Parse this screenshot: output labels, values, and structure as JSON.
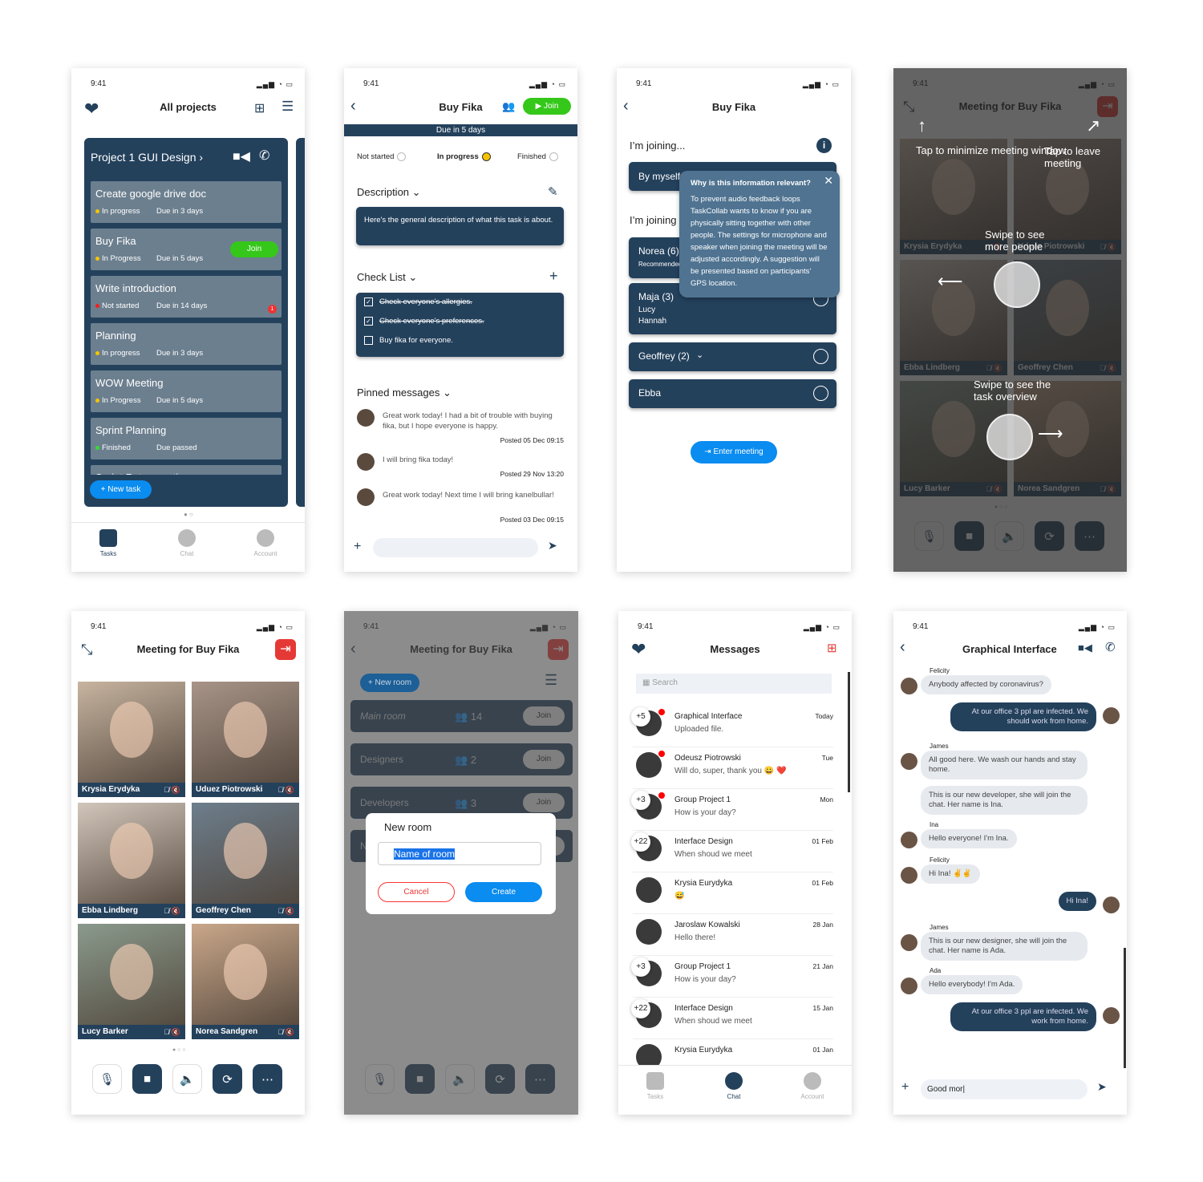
{
  "status_time": "9:41",
  "colors": {
    "navy": "#24415c",
    "accent_blue": "#0a8cf0",
    "join_green": "#35c81a",
    "danger_red": "#e53935",
    "in_progress": "#f5c400",
    "not_started": "#f02020",
    "finished": "#33dd33"
  },
  "screen1": {
    "title": "All projects",
    "project_title": "Project 1 GUI Design",
    "new_task": "New task",
    "tasks": [
      {
        "title": "Create google drive doc",
        "status": "In progress",
        "status_color": "#f5c400",
        "due": "Due in 3 days"
      },
      {
        "title": "Buy Fika",
        "status": "In Progress",
        "status_color": "#f5c400",
        "due": "Due in 5 days",
        "join": "Join"
      },
      {
        "title": "Write introduction",
        "status": "Not started",
        "status_color": "#f02020",
        "due": "Due in 14 days",
        "badge": "1"
      },
      {
        "title": "Planning",
        "status": "In progress",
        "status_color": "#f5c400",
        "due": "Due in 3 days"
      },
      {
        "title": "WOW Meeting",
        "status": "In Progress",
        "status_color": "#f5c400",
        "due": "Due in 5 days"
      },
      {
        "title": "Sprint Planning",
        "status": "Finished",
        "status_color": "#33dd33",
        "due": "Due passed"
      },
      {
        "title": "Sprint Retrospective",
        "status": "",
        "due": ""
      }
    ],
    "tabs": [
      "Tasks",
      "Chat",
      "Account"
    ],
    "active_tab": "Tasks"
  },
  "screen2": {
    "title": "Buy Fika",
    "join": "Join",
    "due_bar": "Due in 5 days",
    "statuses": [
      "Not started",
      "In progress",
      "Finished"
    ],
    "selected_status": "In progress",
    "description_label": "Description",
    "description": "Here's the general description of what this task is about.",
    "checklist_label": "Check List",
    "checklist": [
      {
        "text": "Check everyone's allergies.",
        "checked": true
      },
      {
        "text": "Check everyone's preferences.",
        "checked": true
      },
      {
        "text": "Buy fika for everyone.",
        "checked": false
      }
    ],
    "pinned_label": "Pinned messages",
    "pinned": [
      {
        "text": "Great work today! I had a bit of trouble with buying fika, but I hope everyone is happy.",
        "posted": "Posted 05 Dec 09:15"
      },
      {
        "text": "I will bring fika today!",
        "posted": "Posted 29 Nov 13:20"
      },
      {
        "text": "Great work today! Next time I will bring kanelbullar!",
        "posted": "Posted 03 Dec 09:15"
      }
    ]
  },
  "screen3": {
    "title": "Buy Fika",
    "joining_label": "I’m joining...",
    "by_myself": "By myself",
    "joining_with": "I’m joining",
    "groups": [
      {
        "name": "Norea (6)",
        "sub": "Recommended"
      },
      {
        "name": "Maja (3)",
        "members": [
          "Lucy",
          "Hannah"
        ]
      },
      {
        "name": "Geoffrey (2)"
      },
      {
        "name": "Ebba"
      }
    ],
    "tooltip_title": "Why is this information relevant?",
    "tooltip_body": "To prevent audio feedback loops TaskCollab wants to know if you are physically sitting together with other people. The settings for microphone and speaker when joining the meeting will be adjusted accordingly. A suggestion will be presented based on  participants’ GPS location.",
    "enter_meeting": "Enter meeting"
  },
  "meeting": {
    "title": "Meeting for Buy Fika",
    "participants": [
      "Krysia  Erydyka",
      "Uduez Piotrowski",
      "Ebba Lindberg",
      "Geoffrey Chen",
      "Lucy Barker",
      "Norea Sandgren"
    ]
  },
  "screen4": {
    "hint_minimize": "Tap to minimize meeting window",
    "hint_leave": "Tap to leave meeting",
    "hint_more": "Swipe to see more people",
    "hint_task": "Swipe to see the task overview"
  },
  "screen6": {
    "new_room_button": "+ New room",
    "rooms": [
      {
        "name": "Main room",
        "count": "14"
      },
      {
        "name": "Designers",
        "count": "2"
      },
      {
        "name": "Developers",
        "count": "3"
      },
      {
        "name": "N",
        "count": ""
      }
    ],
    "join": "Join",
    "dialog_title": "New room",
    "dialog_value": "Name of room",
    "cancel": "Cancel",
    "create": "Create"
  },
  "screen7": {
    "title": "Messages",
    "search_placeholder": "Search",
    "chats": [
      {
        "count": "+5",
        "name": "Graphical Interface",
        "text": "Uploaded file.",
        "date": "Today",
        "unread": true
      },
      {
        "name": "Odeusz Piotrowski",
        "text": "Will do, super, thank you  😀 ❤️",
        "date": "Tue",
        "unread": true
      },
      {
        "count": "+3",
        "name": "Group Project 1",
        "text": "How is your day?",
        "date": "Mon",
        "unread": true
      },
      {
        "count": "+22",
        "name": "Interface Design",
        "text": "When shoud we meet",
        "date": "01 Feb"
      },
      {
        "name": "Krysia Eurydyka",
        "text": "😅",
        "date": "01 Feb"
      },
      {
        "name": "Jaroslaw Kowalski",
        "text": "Hello there!",
        "date": "28 Jan"
      },
      {
        "count": "+3",
        "name": "Group Project 1",
        "text": "How is your day?",
        "date": "21 Jan"
      },
      {
        "count": "+22",
        "name": "Interface Design",
        "text": "When shoud we meet",
        "date": "15 Jan"
      },
      {
        "name": "Krysia Eurydyka",
        "text": "",
        "date": "01 Jan"
      }
    ],
    "tabs": [
      "Tasks",
      "Chat",
      "Account"
    ],
    "active_tab": "Chat"
  },
  "screen8": {
    "title": "Graphical Interface",
    "input_value": "Good mor|",
    "messages": [
      {
        "sender": "Felicity",
        "text": "Anybody affected by coronavirus?",
        "dir": "in"
      },
      {
        "text": "At our office 3 ppl are infected. We should work from home.",
        "dir": "out"
      },
      {
        "sender": "James",
        "text": "All good here. We wash our hands and stay home.",
        "dir": "in"
      },
      {
        "text": "This is our new developer, she will join the chat. Her name is Ina.",
        "dir": "in"
      },
      {
        "sender": "Ina",
        "text": "Hello everyone! I'm Ina.",
        "dir": "in"
      },
      {
        "sender": "Felicity",
        "text": "Hi Ina!  ✌️✌️",
        "dir": "in"
      },
      {
        "text": "Hi Ina!",
        "dir": "out"
      },
      {
        "sender": "James",
        "text": "This is our new designer, she will join the chat. Her name is Ada.",
        "dir": "in"
      },
      {
        "sender": "Ada",
        "text": "Hello everybody! I'm Ada.",
        "dir": "in"
      },
      {
        "text": "At our office 3 ppl are infected. We work from home.",
        "dir": "out"
      }
    ]
  }
}
